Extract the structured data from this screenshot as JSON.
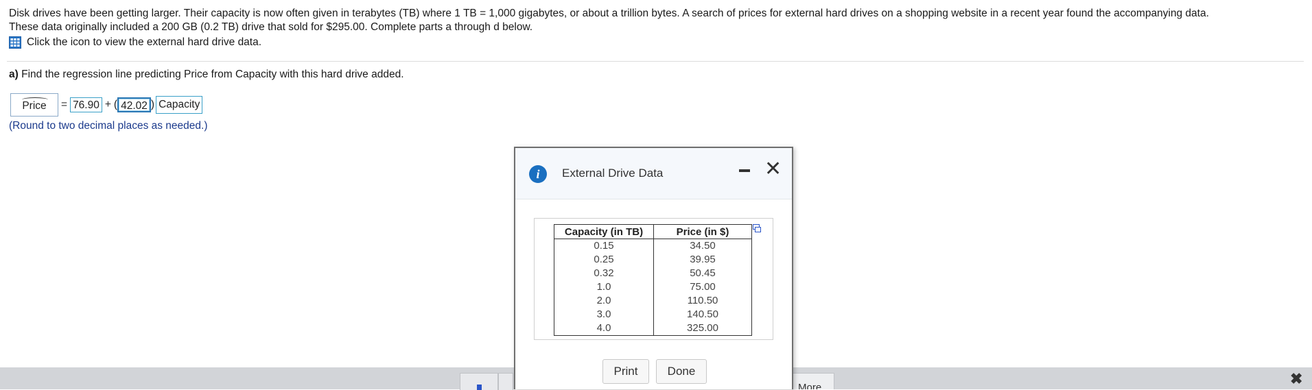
{
  "intro": {
    "line1": "Disk drives have been getting larger. Their capacity is now often given in terabytes (TB) where 1 TB = 1,000 gigabytes, or about a trillion bytes. A search of prices for external hard drives on a shopping website in a recent year found the accompanying data.",
    "line2": "These data originally included a 200 GB (0.2 TB) drive that sold for $295.00. Complete parts a through d below."
  },
  "data_link": {
    "label": "Click the icon to view the external hard drive data."
  },
  "part_a": {
    "label": "a)",
    "text": "Find the regression line predicting Price from Capacity with this hard drive added."
  },
  "equation": {
    "lhs": "Price",
    "equals": "=",
    "intercept": "76.90",
    "plus": "+",
    "open_paren": "(",
    "slope": "42.02",
    "close_paren": ")",
    "variable": "Capacity"
  },
  "round_note": "(Round to two decimal places as needed.)",
  "dialog": {
    "title": "External Drive Data",
    "columns": [
      "Capacity (in TB)",
      "Price (in $)"
    ],
    "rows": [
      [
        "0.15",
        "34.50"
      ],
      [
        "0.25",
        "39.95"
      ],
      [
        "0.32",
        "50.45"
      ],
      [
        "1.0",
        "75.00"
      ],
      [
        "2.0",
        "110.50"
      ],
      [
        "3.0",
        "140.50"
      ],
      [
        "4.0",
        "325.00"
      ]
    ],
    "print_label": "Print",
    "done_label": "Done"
  },
  "bottom_bar": {
    "more_label": "More",
    "close_glyph": "✖"
  },
  "colors": {
    "accent": "#1a6fc0",
    "note_text": "#1b3a8c",
    "answer_border": "#3aa0c8"
  }
}
